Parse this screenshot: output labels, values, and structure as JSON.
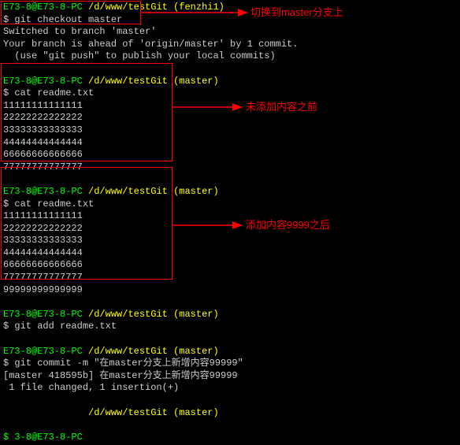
{
  "block1": {
    "promptUser": "E73-8@E73-8-PC",
    "promptPath": "/d/www/testGit",
    "promptBranch": "(fenzhi1)",
    "dollar": "$",
    "cmd": "git checkout master",
    "out1": "Switched to branch 'master'",
    "out2": "Your branch is ahead of 'origin/master' by 1 commit.",
    "out3": "  (use \"git push\" to publish your local commits)"
  },
  "block2": {
    "promptUser": "E73-8@E73-8-PC",
    "promptPath": "/d/www/testGit",
    "promptBranch": "(master)",
    "dollar": "$",
    "cmd": "cat readme.txt",
    "lines": [
      "11111111111111",
      "22222222222222",
      "33333333333333",
      "44444444444444",
      "66666666666666",
      "77777777777777"
    ]
  },
  "block3": {
    "promptUser": "E73-8@E73-8-PC",
    "promptPath": "/d/www/testGit",
    "promptBranch": "(master)",
    "dollar": "$",
    "cmd": "cat readme.txt",
    "lines": [
      "11111111111111",
      "22222222222222",
      "33333333333333",
      "44444444444444",
      "66666666666666",
      "77777777777777",
      "99999999999999"
    ]
  },
  "block4": {
    "promptUser": "E73-8@E73-8-PC",
    "promptPath": "/d/www/testGit",
    "promptBranch": "(master)",
    "dollar": "$",
    "cmd": "git add readme.txt"
  },
  "block5": {
    "promptUser": "E73-8@E73-8-PC",
    "promptPath": "/d/www/testGit",
    "promptBranch": "(master)",
    "dollar": "$",
    "cmd": "git commit -m \"在master分支上新增内容99999\"",
    "out1": "[master 418595b] 在master分支上新增内容99999",
    "out2": " 1 file changed, 1 insertion(+)"
  },
  "block6": {
    "promptPath": "/d/www/testGit",
    "promptBranch": "(master)",
    "promptUser": "3-8@E73-8-PC",
    "dollar": "$"
  },
  "annotations": {
    "a1": "切换到master分支上",
    "a2": "未添加内容之前",
    "a3": "添加内容9999之后"
  }
}
